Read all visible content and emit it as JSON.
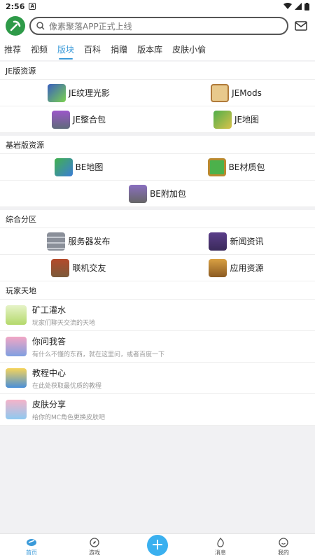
{
  "status": {
    "time": "2:56",
    "notif": "A"
  },
  "header": {
    "search_placeholder": "像素聚落APP正式上线"
  },
  "tabs": [
    {
      "label": "推荐"
    },
    {
      "label": "视频"
    },
    {
      "label": "版块"
    },
    {
      "label": "百科"
    },
    {
      "label": "捐赠"
    },
    {
      "label": "版本库"
    },
    {
      "label": "皮肤小偷"
    }
  ],
  "sections": {
    "je": {
      "title": "JE版资源",
      "items": [
        {
          "label": "JE纹理光影"
        },
        {
          "label": "JEMods"
        },
        {
          "label": "JE整合包"
        },
        {
          "label": "JE地图"
        }
      ]
    },
    "be": {
      "title": "基岩版资源",
      "items": [
        {
          "label": "BE地图"
        },
        {
          "label": "BE材质包"
        },
        {
          "label": "BE附加包"
        }
      ]
    },
    "misc": {
      "title": "综合分区",
      "items": [
        {
          "label": "服务器发布"
        },
        {
          "label": "新闻资讯"
        },
        {
          "label": "联机交友"
        },
        {
          "label": "应用资源"
        }
      ]
    },
    "players": {
      "title": "玩家天地",
      "items": [
        {
          "title": "矿工灌水",
          "desc": "玩家们聊天交流的天地"
        },
        {
          "title": "你问我答",
          "desc": "有什么不懂的东西，就在这里问，或者百度一下"
        },
        {
          "title": "教程中心",
          "desc": "在此处获取最优质的教程"
        },
        {
          "title": "皮肤分享",
          "desc": "给你的MC角色更换皮肤吧"
        }
      ]
    }
  },
  "bottom_nav": [
    {
      "label": "首页"
    },
    {
      "label": "游戏"
    },
    {
      "label": "+"
    },
    {
      "label": "消息"
    },
    {
      "label": "我的"
    }
  ],
  "colors": {
    "accent": "#3a9ad9",
    "plus": "#3ab0ef"
  }
}
